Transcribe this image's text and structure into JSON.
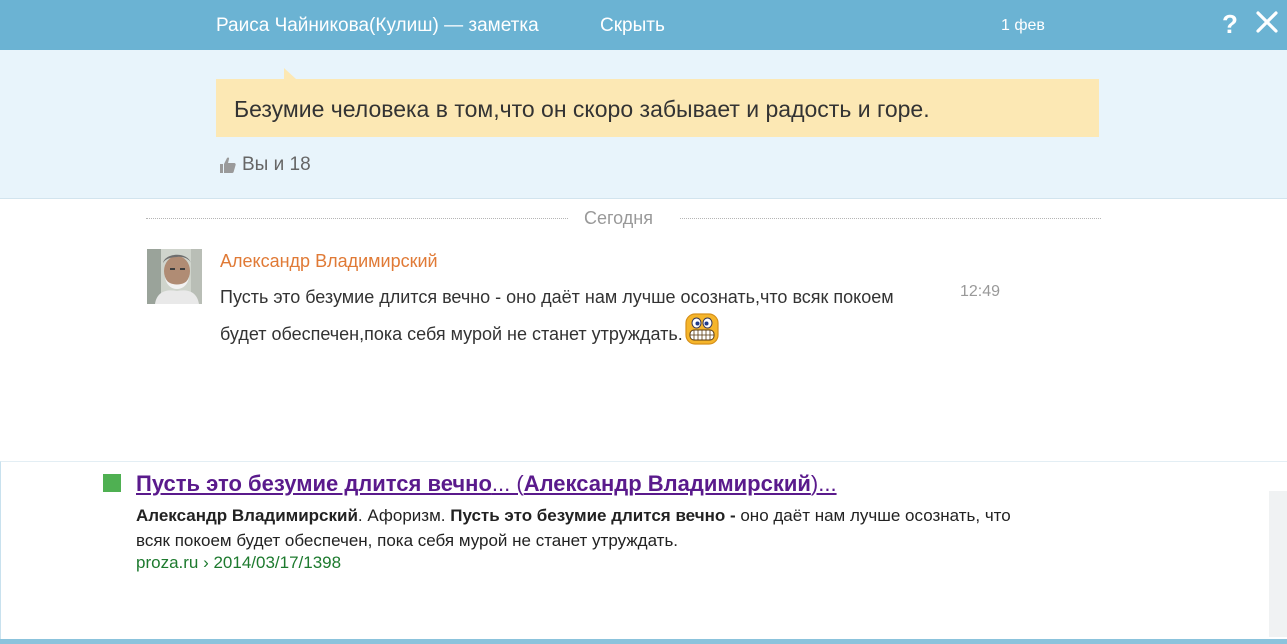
{
  "header": {
    "title": "Раиса Чайникова(Кулиш) — заметка",
    "hide_label": "Скрыть",
    "date": "1 фев",
    "help_label": "?"
  },
  "note": {
    "text": "Безумие человека в том,что он скоро забывает и радость и горе.",
    "likes_label": "Вы и 18"
  },
  "divider": {
    "label": "Сегодня"
  },
  "comment": {
    "author": "Александр Владимирский",
    "text": "Пусть это безумие длится вечно - оно даёт нам лучше осознать,что всяк покоем будет обеспечен,пока себя мурой не станет утруждать.",
    "time": "12:49"
  },
  "search_result": {
    "title_bold_1": "Пусть это безумие длится вечно",
    "title_plain_1": "... (",
    "title_bold_2": "Александр Владимирский",
    "title_plain_2": ")...",
    "snippet_bold_1": "Александр Владимирский",
    "snippet_plain_1": ". Афоризм. ",
    "snippet_bold_2": "Пусть это безумие длится вечно -",
    "snippet_plain_2": " оно даёт нам лучше осознать, что всяк покоем будет обеспечен, пока себя мурой не станет утруждать.",
    "url": "proza.ru › 2014/03/17/1398"
  },
  "colors": {
    "header_bg": "#6bb3d3",
    "note_bg": "#fce8b4",
    "author": "#e07a36",
    "link_title": "#5a1a8c",
    "url": "#1d7a2e",
    "square": "#4fb052"
  }
}
